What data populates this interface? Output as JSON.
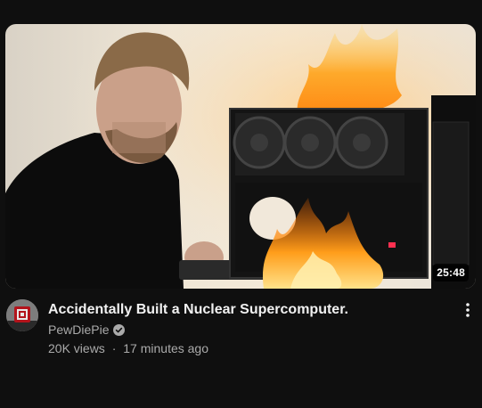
{
  "video": {
    "title": "Accidentally Built a Nuclear Supercomputer.",
    "duration": "25:48",
    "channel": "PewDiePie",
    "views": "20K views",
    "separator": "·",
    "age": "17 minutes ago",
    "verified_icon": "verified-check-icon",
    "menu_icon": "more-vertical-icon"
  },
  "colors": {
    "background": "#0f0f0f",
    "title": "#f1f1f1",
    "secondary_text": "#aaaaaa",
    "duration_badge_bg": "#000000"
  }
}
